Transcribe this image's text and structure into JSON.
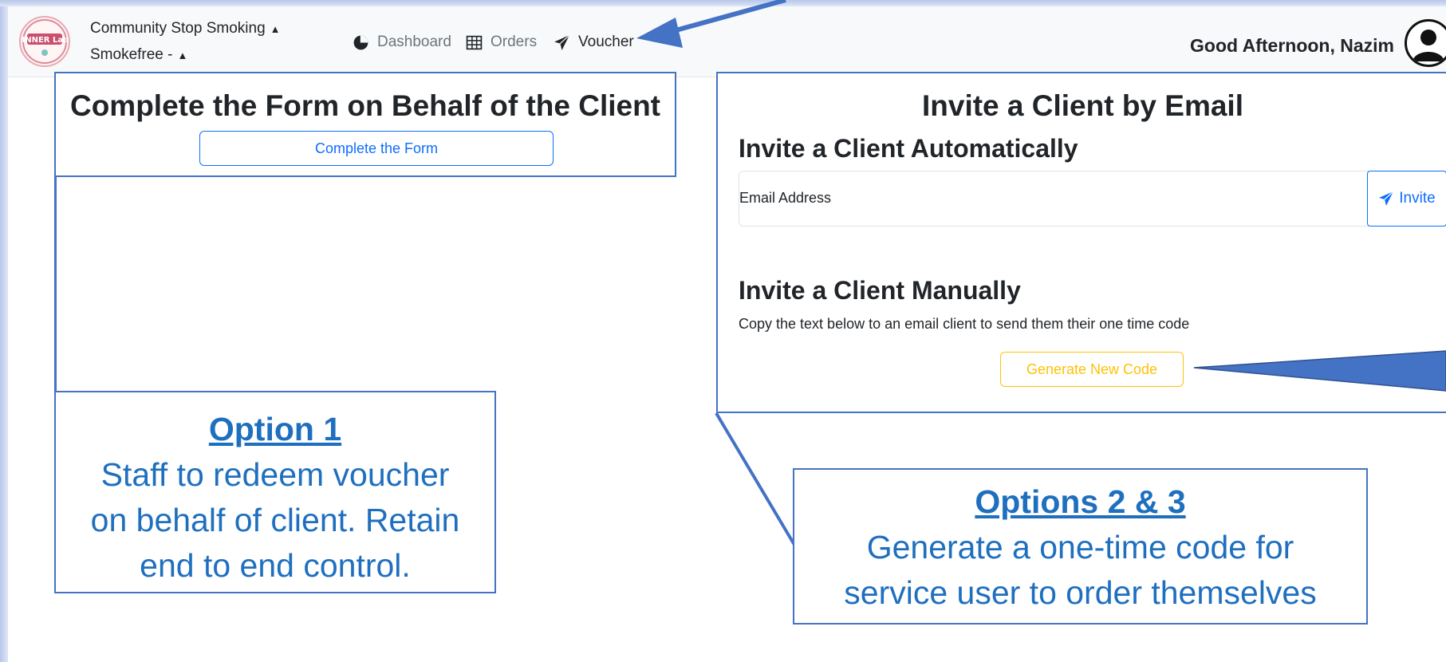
{
  "navbar": {
    "logo_text": "DINNER Lady",
    "org_selector": "Community Stop Smoking",
    "sub_selector": "Smokefree -",
    "links": [
      {
        "label": "Dashboard",
        "icon": "pie-chart-icon"
      },
      {
        "label": "Orders",
        "icon": "table-icon"
      },
      {
        "label": "Voucher",
        "icon": "send-icon"
      }
    ],
    "greeting": "Good Afternoon, Nazim"
  },
  "left_panel": {
    "title": "Complete the Form on Behalf of the Client",
    "button_label": "Complete the Form"
  },
  "right_panel": {
    "title": "Invite a Client by Email",
    "auto_heading": "Invite a Client Automatically",
    "email_placeholder": "Email Address",
    "invite_label": "Invite",
    "manual_heading": "Invite a Client Manually",
    "manual_text": "Copy the text below to an email client to send them their one time code",
    "generate_label": "Generate New Code"
  },
  "callouts": {
    "option1_title": "Option 1",
    "option1_text_1": "Staff to redeem voucher",
    "option1_text_2": "on behalf of client. Retain",
    "option1_text_3": "end to end control.",
    "option23_title": "Options 2 & 3",
    "option23_text_1": "Generate a one-time code for",
    "option23_text_2": "service user to order themselves"
  },
  "colors": {
    "annotation_blue": "#4472c4",
    "callout_text": "#1f6fbf",
    "primary": "#0d6efd",
    "warning": "#ffc107"
  }
}
